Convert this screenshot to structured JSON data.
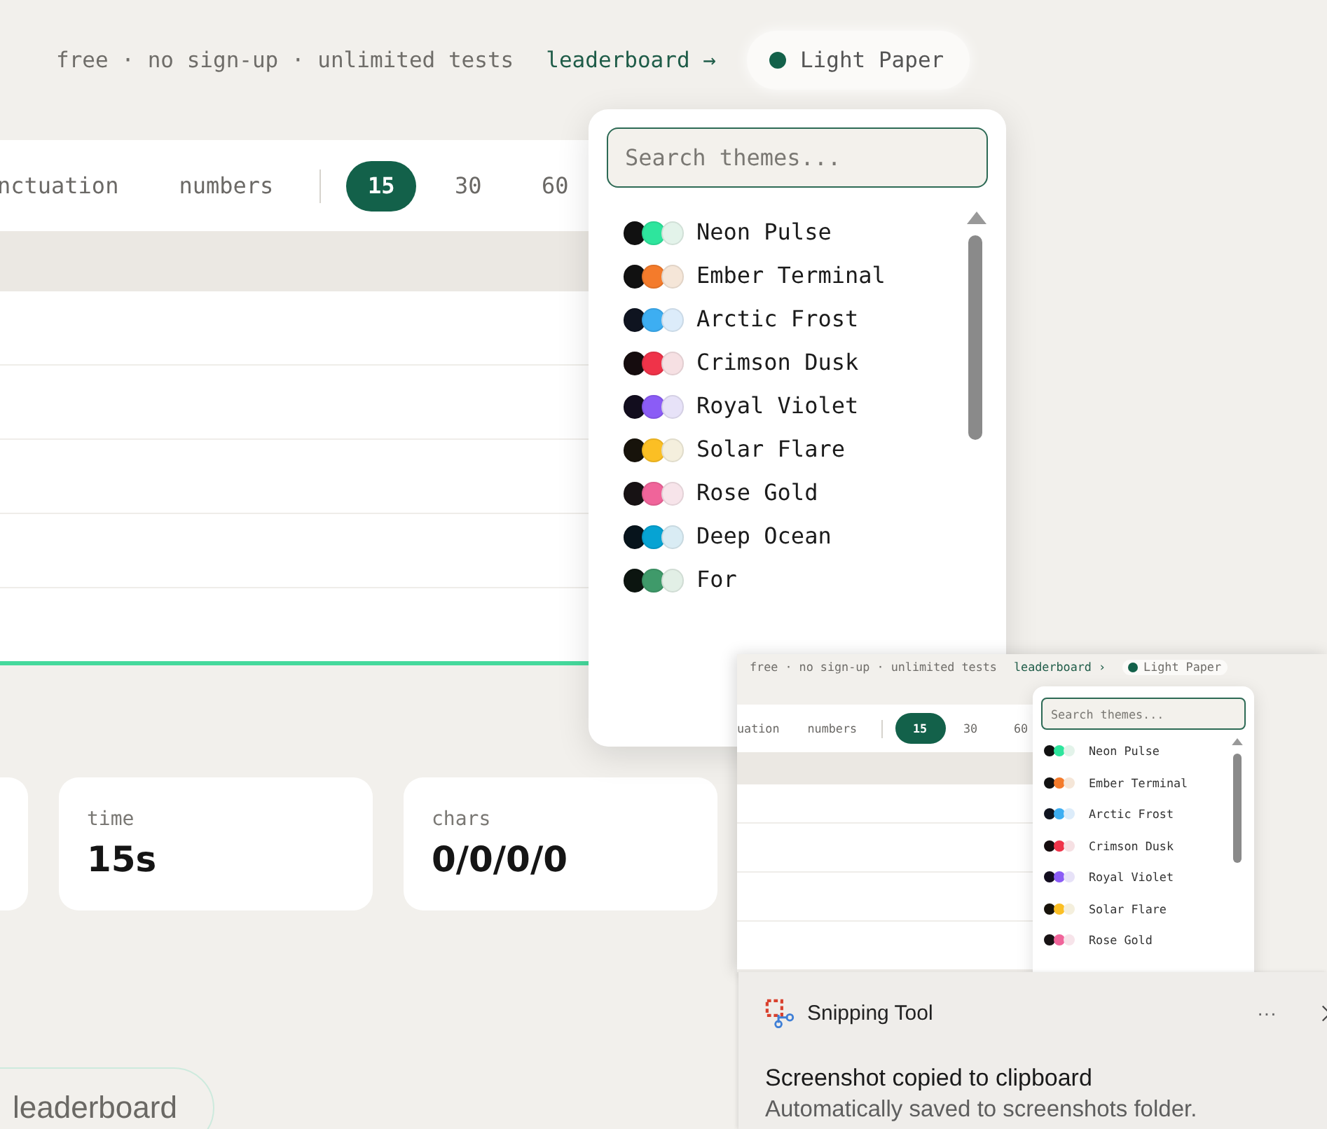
{
  "header": {
    "tagline": "free · no sign-up · unlimited tests",
    "leaderboard_link": "leaderboard →",
    "theme_button": {
      "label": "Light Paper",
      "color": "#13614a"
    }
  },
  "modes": [
    {
      "label": "nctuation",
      "on": false
    },
    {
      "label": "numbers",
      "on": false
    }
  ],
  "durations": [
    {
      "label": "15",
      "selected": true
    },
    {
      "label": "30",
      "selected": false
    },
    {
      "label": "60",
      "selected": false
    }
  ],
  "stats": [
    {
      "label": "time",
      "value": "15s"
    },
    {
      "label": "chars",
      "value": "0/0/0/0"
    }
  ],
  "leaderboard_button": "leaderboard",
  "theme_menu": {
    "placeholder": "Search themes...",
    "themes": [
      {
        "name": "Neon Pulse",
        "swatches": [
          {
            "color": "#111111"
          },
          {
            "color": "#2ee59d"
          },
          {
            "color": "#e3f3ea"
          }
        ]
      },
      {
        "name": "Ember Terminal",
        "swatches": [
          {
            "color": "#111111"
          },
          {
            "color": "#f47b2b"
          },
          {
            "color": "#f5e6d8"
          }
        ]
      },
      {
        "name": "Arctic Frost",
        "swatches": [
          {
            "color": "#0f1420"
          },
          {
            "color": "#3daef2"
          },
          {
            "color": "#dcecfa"
          }
        ]
      },
      {
        "name": "Crimson Dusk",
        "swatches": [
          {
            "color": "#150c0e"
          },
          {
            "color": "#ef3349"
          },
          {
            "color": "#f6e0e3"
          }
        ]
      },
      {
        "name": "Royal Violet",
        "swatches": [
          {
            "color": "#120d1e"
          },
          {
            "color": "#8b5cf6"
          },
          {
            "color": "#e7e2f8"
          }
        ]
      },
      {
        "name": "Solar Flare",
        "swatches": [
          {
            "color": "#17130b"
          },
          {
            "color": "#fbbf24"
          },
          {
            "color": "#f4efdd"
          }
        ]
      },
      {
        "name": "Rose Gold",
        "swatches": [
          {
            "color": "#171214"
          },
          {
            "color": "#f0649a"
          },
          {
            "color": "#f7e4ea"
          }
        ]
      },
      {
        "name": "Deep Ocean",
        "swatches": [
          {
            "color": "#07141c"
          },
          {
            "color": "#06a3d3"
          },
          {
            "color": "#d9ecf4"
          }
        ]
      },
      {
        "name": "For",
        "swatches": [
          {
            "color": "#0c1510"
          },
          {
            "color": "#3f9a6a"
          },
          {
            "color": "#e2efe6"
          }
        ]
      }
    ]
  },
  "screenshot_preview": {
    "tagline": "free · no sign-up · unlimited tests",
    "leaderboard_link": "leaderboard ›",
    "theme_button": {
      "label": "Light Paper",
      "color": "#13614a"
    },
    "modes": [
      {
        "label": "uation",
        "on": false
      },
      {
        "label": "numbers",
        "on": false
      }
    ],
    "durations": [
      {
        "label": "15",
        "selected": true
      },
      {
        "label": "30",
        "selected": false
      },
      {
        "label": "60",
        "selected": false
      }
    ],
    "placeholder": "Search themes...",
    "themes": [
      {
        "name": "Neon Pulse",
        "swatches": [
          {
            "color": "#111111"
          },
          {
            "color": "#2ee59d"
          },
          {
            "color": "#e3f3ea"
          }
        ]
      },
      {
        "name": "Ember Terminal",
        "swatches": [
          {
            "color": "#111111"
          },
          {
            "color": "#f47b2b"
          },
          {
            "color": "#f5e6d8"
          }
        ]
      },
      {
        "name": "Arctic Frost",
        "swatches": [
          {
            "color": "#0f1420"
          },
          {
            "color": "#3daef2"
          },
          {
            "color": "#dcecfa"
          }
        ]
      },
      {
        "name": "Crimson Dusk",
        "swatches": [
          {
            "color": "#150c0e"
          },
          {
            "color": "#ef3349"
          },
          {
            "color": "#f6e0e3"
          }
        ]
      },
      {
        "name": "Royal Violet",
        "swatches": [
          {
            "color": "#120d1e"
          },
          {
            "color": "#8b5cf6"
          },
          {
            "color": "#e7e2f8"
          }
        ]
      },
      {
        "name": "Solar Flare",
        "swatches": [
          {
            "color": "#17130b"
          },
          {
            "color": "#fbbf24"
          },
          {
            "color": "#f4efdd"
          }
        ]
      },
      {
        "name": "Rose Gold",
        "swatches": [
          {
            "color": "#171214"
          },
          {
            "color": "#f0649a"
          },
          {
            "color": "#f7e4ea"
          }
        ]
      }
    ]
  },
  "notification": {
    "app": "Snipping Tool",
    "more": "···",
    "title": "Screenshot copied to clipboard",
    "body": "Automatically saved to screenshots folder."
  }
}
